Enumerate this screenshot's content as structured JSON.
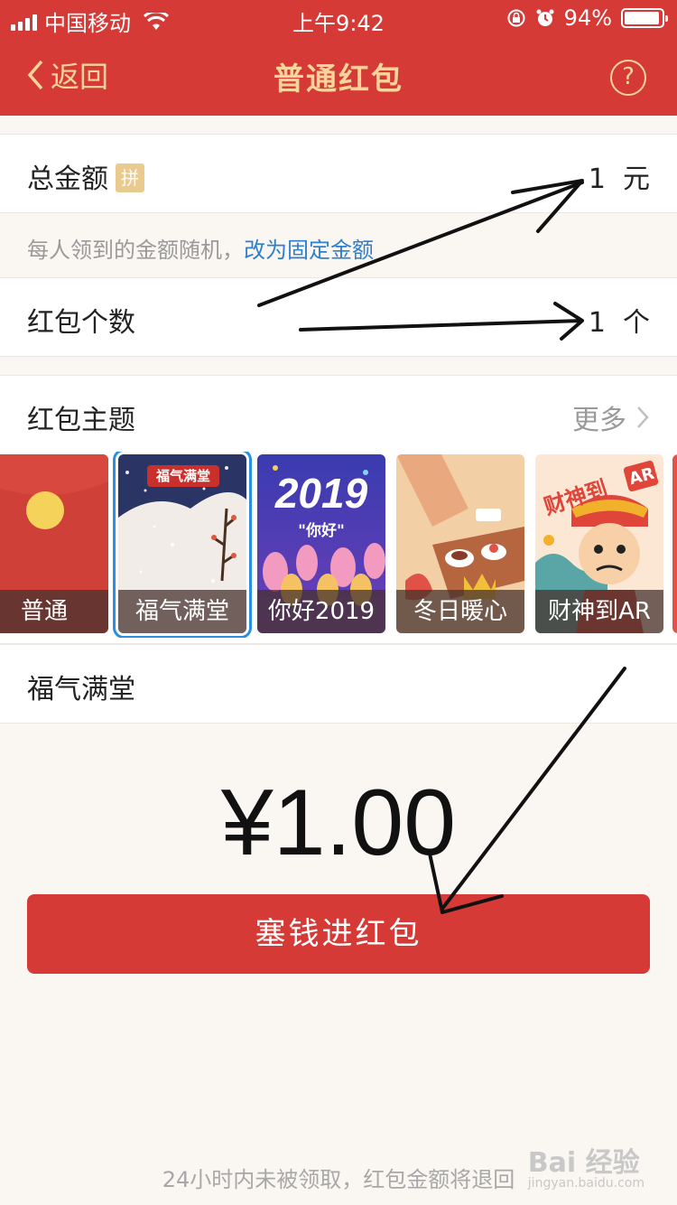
{
  "status_bar": {
    "carrier": "中国移动",
    "time": "上午9:42",
    "battery": "94%",
    "battery_level": 0.94
  },
  "nav": {
    "back_label": "返回",
    "title": "普通红包",
    "help_label": "?"
  },
  "total": {
    "label": "总金额",
    "badge": "拼",
    "value": "1",
    "unit": "元"
  },
  "hint": {
    "text": "每人领到的金额随机，",
    "link": "改为固定金额"
  },
  "count": {
    "label": "红包个数",
    "value": "1",
    "unit": "个"
  },
  "theme": {
    "label": "红包主题",
    "more": "更多",
    "cards": [
      {
        "caption": "普通"
      },
      {
        "caption": "福气满堂",
        "banner": "福气满堂",
        "selected": true
      },
      {
        "caption": "你好2019",
        "year": "2019",
        "sub": "\"你好\""
      },
      {
        "caption": "冬日暖心"
      },
      {
        "caption": "财神到AR",
        "banner": "财神到",
        "tag": "AR"
      }
    ]
  },
  "greeting": "福气满堂",
  "amount": "¥1.00",
  "submit_label": "塞钱进红包",
  "footer": "24小时内未被领取，红包金额将退回",
  "watermark": {
    "main": "Bai 经验",
    "sub": "jingyan.baidu.com"
  },
  "colors": {
    "brand_red": "#d63a37",
    "gold": "#f6d49a",
    "link_blue": "#2f7fcc",
    "selected_blue": "#2a8fe0"
  }
}
